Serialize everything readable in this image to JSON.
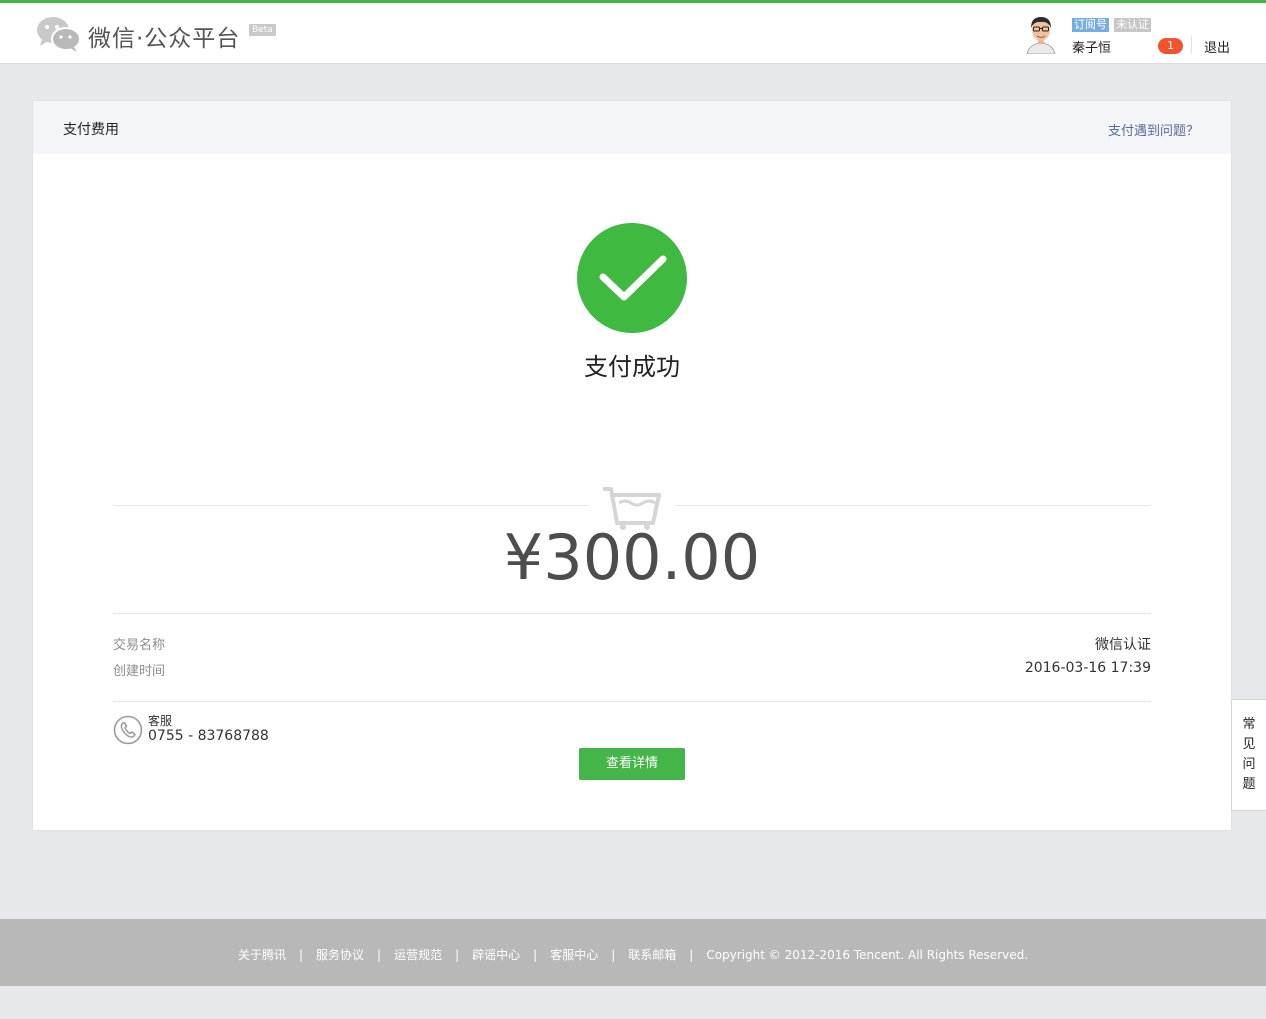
{
  "header": {
    "brand": "微信·公众平台",
    "beta": "Beta",
    "account_type_tag": "订阅号",
    "verify_tag": "未认证",
    "username": "秦子恒",
    "message_count": "1",
    "logout": "退出"
  },
  "card": {
    "title": "支付费用",
    "help_link": "支付遇到问题？",
    "status": "支付成功",
    "amount": "¥300.00",
    "rows": [
      {
        "label": "交易名称",
        "value": "微信认证"
      },
      {
        "label": "创建时间",
        "value": "2016-03-16 17:39"
      }
    ],
    "service_label": "客服",
    "service_phone": "0755 - 83768788",
    "detail_button": "查看详情"
  },
  "faq_tab": [
    "常",
    "见",
    "问",
    "题"
  ],
  "footer": {
    "links": [
      "关于腾讯",
      "服务协议",
      "运营规范",
      "辟谣中心",
      "客服中心",
      "联系邮箱"
    ],
    "copyright": "Copyright © 2012-2016 Tencent. All Rights Reserved."
  },
  "colors": {
    "brand_green": "#44b549",
    "success_green": "#3fb93f",
    "link_blue": "#576b95",
    "badge_red": "#f0532d",
    "footer_gray": "#b8b8b8"
  }
}
